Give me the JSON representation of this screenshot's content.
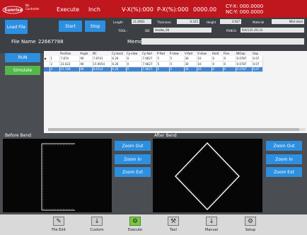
{
  "topbar": {
    "nc_line1": "No",
    "nc_line2": "Controller",
    "mode": "Execute",
    "unit": "Inch",
    "vx": "V-X(%):000",
    "px": "P-X(%):000",
    "time": "0000.00",
    "cyx": "CY-X:  000.0000",
    "ncy": "NC-Y:  000.0000"
  },
  "control": {
    "load_file": "Load File",
    "start": "Start",
    "stop": "Stop",
    "length_label": "Length",
    "length_value": "21.6981",
    "thickness_label": "Thickness",
    "thickness_value": "0.315",
    "height_label": "Height",
    "height_value": "3.937",
    "material_label": "Material",
    "material_value": "Mild steel",
    "tool_label": "TOOL :",
    "die_label": "DIE",
    "die_value": "Vee8w_90",
    "punch_label": "PUNCH",
    "punch_value": "R/4/135 (R1.0)",
    "file_name_label": "File Name",
    "file_name_value": "22667788",
    "memo_label": "Memo",
    "run": "RUN",
    "simulate": "Simulate"
  },
  "table": {
    "headers": [
      "",
      "",
      "Position",
      "Angle",
      "NC",
      "Cy-back",
      "Cy-slow",
      "Cy-fwd",
      "P-fwd",
      "P-slow",
      "V-fwd",
      "V-slow",
      "Hold",
      "Flex",
      "NtGap",
      "Gap"
    ],
    "rows": [
      [
        "▶",
        "1",
        "7.874",
        "90",
        "7.8741",
        "6.26",
        "0",
        "7.6627",
        "5",
        "5",
        "30",
        "10",
        "0",
        "0",
        "0.0787",
        "0.07"
      ],
      [
        "",
        "2",
        "23.622",
        "90",
        "15.9054",
        "6.26",
        "0",
        "7.6627",
        "5",
        "5",
        "30",
        "10",
        "0",
        "0",
        "0.0787",
        "0.07"
      ],
      [
        "",
        "3",
        "15.748",
        "90",
        "8.6314",
        "6.26",
        "0",
        "7.6627",
        "5",
        "5",
        "30",
        "10",
        "0",
        "0",
        "0.0787",
        "0.07"
      ]
    ],
    "selected_row": 2
  },
  "before_bend": {
    "label": "Before Bend",
    "zoom_out": "Zoom Out",
    "zoom_in": "Zoom In",
    "zoom_ext": "Zoom Ext"
  },
  "after_bend": {
    "label": "After Bend",
    "zoom_out": "Zoom Out",
    "zoom_in": "Zoom In",
    "zoom_ext": "Zoom Ext"
  },
  "nav": [
    {
      "label": "File Edit",
      "icon": "file-edit-icon",
      "glyph": "✎"
    },
    {
      "label": "Custom",
      "icon": "custom-icon",
      "glyph": "↓"
    },
    {
      "label": "Execute",
      "icon": "execute-icon",
      "glyph": "⚙"
    },
    {
      "label": "Tool",
      "icon": "tool-icon",
      "glyph": "⚒"
    },
    {
      "label": "Manual",
      "icon": "manual-icon",
      "glyph": "↓"
    },
    {
      "label": "Setup",
      "icon": "setup-icon",
      "glyph": "⚙"
    }
  ],
  "colors": {
    "header_red": "#c0161e",
    "button_blue": "#2c8fe0",
    "run_blue": "#2c8fe0",
    "simulate_green": "#52b84a",
    "selected_row_blue": "#3d86d6",
    "execute_active_green": "#7ac943"
  }
}
